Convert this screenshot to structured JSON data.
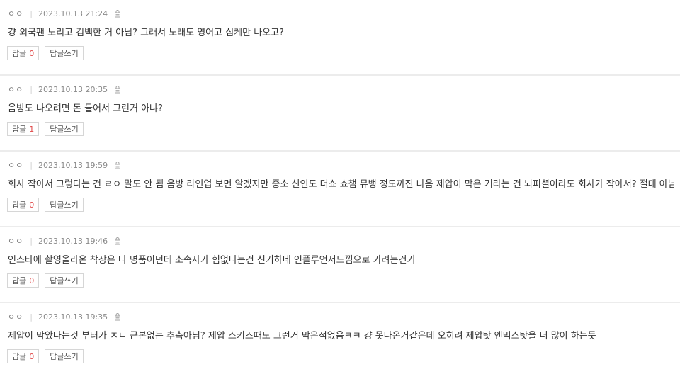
{
  "comments": [
    {
      "author": "ㅇㅇ",
      "date": "2023.10.13 21:24",
      "text": "걍 외국팬 노리고 컴백한 거 아님? 그래서 노래도 영어고 심케만 나오고?",
      "reply_label": "답글",
      "reply_count": "0",
      "write_reply_label": "답글쓰기"
    },
    {
      "author": "ㅇㅇ",
      "date": "2023.10.13 20:35",
      "text": "음방도 나오려면 돈 들어서 그런거 아냐?",
      "reply_label": "답글",
      "reply_count": "1",
      "write_reply_label": "답글쓰기"
    },
    {
      "author": "ㅇㅇ",
      "date": "2023.10.13 19:59",
      "text": "회사 작아서 그렇다는 건 ㄹㅇ 말도 안 됨 음방 라인업 보면 알겠지만 중소 신인도 더쇼 쇼챔 뮤뱅 정도까진 나옴 제압이 막은 거라는 건 뇌피셜이라도 회사가 작아서? 절대 아님",
      "reply_label": "답글",
      "reply_count": "0",
      "write_reply_label": "답글쓰기"
    },
    {
      "author": "ㅇㅇ",
      "date": "2023.10.13 19:46",
      "text": "인스타에 촬영올라온 착장은 다 명품이던데 소속사가 힘없다는건 신기하네 인플루언서느낌으로 가려는건기",
      "reply_label": "답글",
      "reply_count": "0",
      "write_reply_label": "답글쓰기"
    },
    {
      "author": "ㅇㅇ",
      "date": "2023.10.13 19:35",
      "text": "제압이 막았다는것 부터가 ㅈㄴ 근본없는 추측아님? 제압 스키즈때도 그런거 막은적없음ㅋㅋ 걍 못나온거같은데 오히려 제압탓 엔믹스탓을 더 많이 하는듯",
      "reply_label": "답글",
      "reply_count": "0",
      "write_reply_label": "답글쓰기"
    }
  ]
}
